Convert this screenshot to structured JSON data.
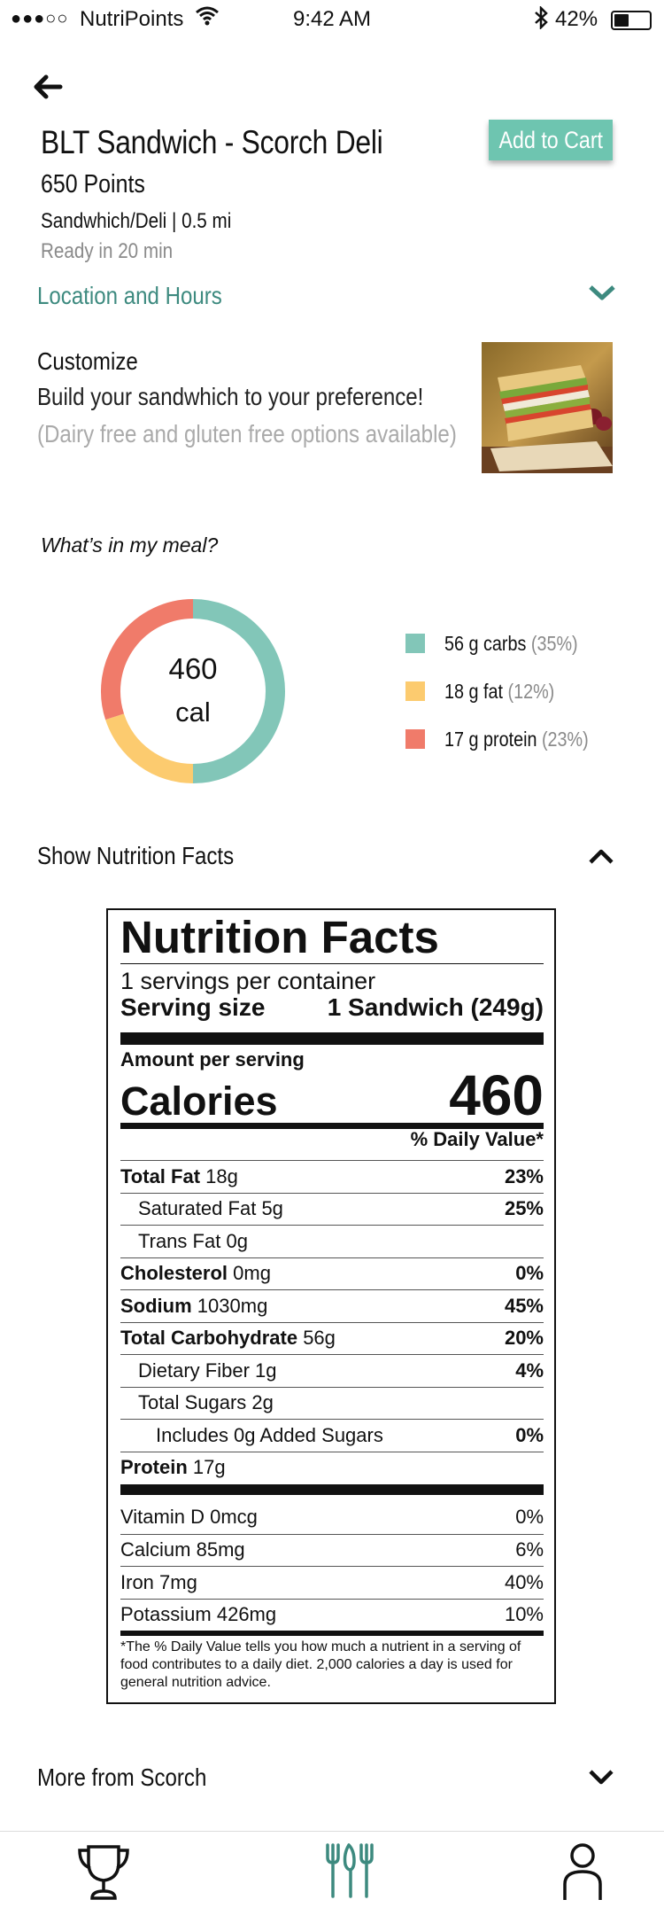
{
  "status_bar": {
    "carrier": "NutriPoints",
    "time": "9:42 AM",
    "battery": "42%",
    "battery_level": 0.42
  },
  "item": {
    "title": "BLT Sandwich - Scorch Deli",
    "points": "650 Points",
    "meta": "Sandwhich/Deli | 0.5 mi",
    "ready": "Ready in 20 min",
    "add_to_cart": "Add to Cart"
  },
  "location_label": "Location and Hours",
  "customize": {
    "heading": "Customize",
    "description": "Build your sandwhich to your preference!",
    "options": "(Dairy free and gluten free options available)"
  },
  "meal": {
    "question": "What’s in my meal?",
    "calories": "460",
    "cal_unit": "cal",
    "legend": [
      {
        "label": "56 g carbs",
        "pct": "(35%)",
        "color": "#82c6b8",
        "share": 50
      },
      {
        "label": "18 g fat",
        "pct": "(12%)",
        "color": "#fccb6f",
        "share": 20
      },
      {
        "label": "17 g protein",
        "pct": "(23%)",
        "color": "#f07b6a",
        "share": 30
      }
    ]
  },
  "nutrition_toggle": "Show Nutrition Facts",
  "nutrition": {
    "title": "Nutrition Facts",
    "servings": "1 servings per container",
    "serving_size_label": "Serving size",
    "serving_size_value": "1 Sandwich (249g)",
    "amount_per_serving": "Amount per serving",
    "calories_label": "Calories",
    "calories_value": "460",
    "daily_value_header": "% Daily Value*",
    "rows": [
      {
        "name": "Total Fat",
        "amount": "18g",
        "dv": "23%"
      },
      {
        "name": "Saturated Fat",
        "amount": "5g",
        "dv": "25%"
      },
      {
        "name": "Trans Fat",
        "amount": "0g",
        "dv": ""
      },
      {
        "name": "Cholesterol",
        "amount": "0mg",
        "dv": "0%"
      },
      {
        "name": "Sodium",
        "amount": "1030mg",
        "dv": "45%"
      },
      {
        "name": "Total Carbohydrate",
        "amount": "56g",
        "dv": "20%"
      },
      {
        "name": "Dietary Fiber",
        "amount": "1g",
        "dv": "4%"
      },
      {
        "name": "Total Sugars",
        "amount": "2g",
        "dv": ""
      },
      {
        "name": "Includes 0g Added Sugars",
        "amount": "",
        "dv": "0%"
      },
      {
        "name": "Protein",
        "amount": "17g",
        "dv": ""
      }
    ],
    "vitamins": [
      {
        "name": "Vitamin D",
        "amount": "0mcg",
        "dv": "0%"
      },
      {
        "name": "Calcium",
        "amount": "85mg",
        "dv": "6%"
      },
      {
        "name": "Iron",
        "amount": "7mg",
        "dv": "40%"
      },
      {
        "name": "Potassium",
        "amount": "426mg",
        "dv": "10%"
      }
    ],
    "footnote": "*The % Daily Value tells you how much a nutrient in a serving of food contributes to a daily diet. 2,000 calories a day is used for general nutrition advice."
  },
  "more_label": "More from Scorch",
  "tabs": [
    {
      "icon": "trophy-icon"
    },
    {
      "icon": "dining-icon"
    },
    {
      "icon": "user-icon"
    }
  ],
  "colors": {
    "accent": "#6ec5b0",
    "link": "#3d8a7f"
  }
}
